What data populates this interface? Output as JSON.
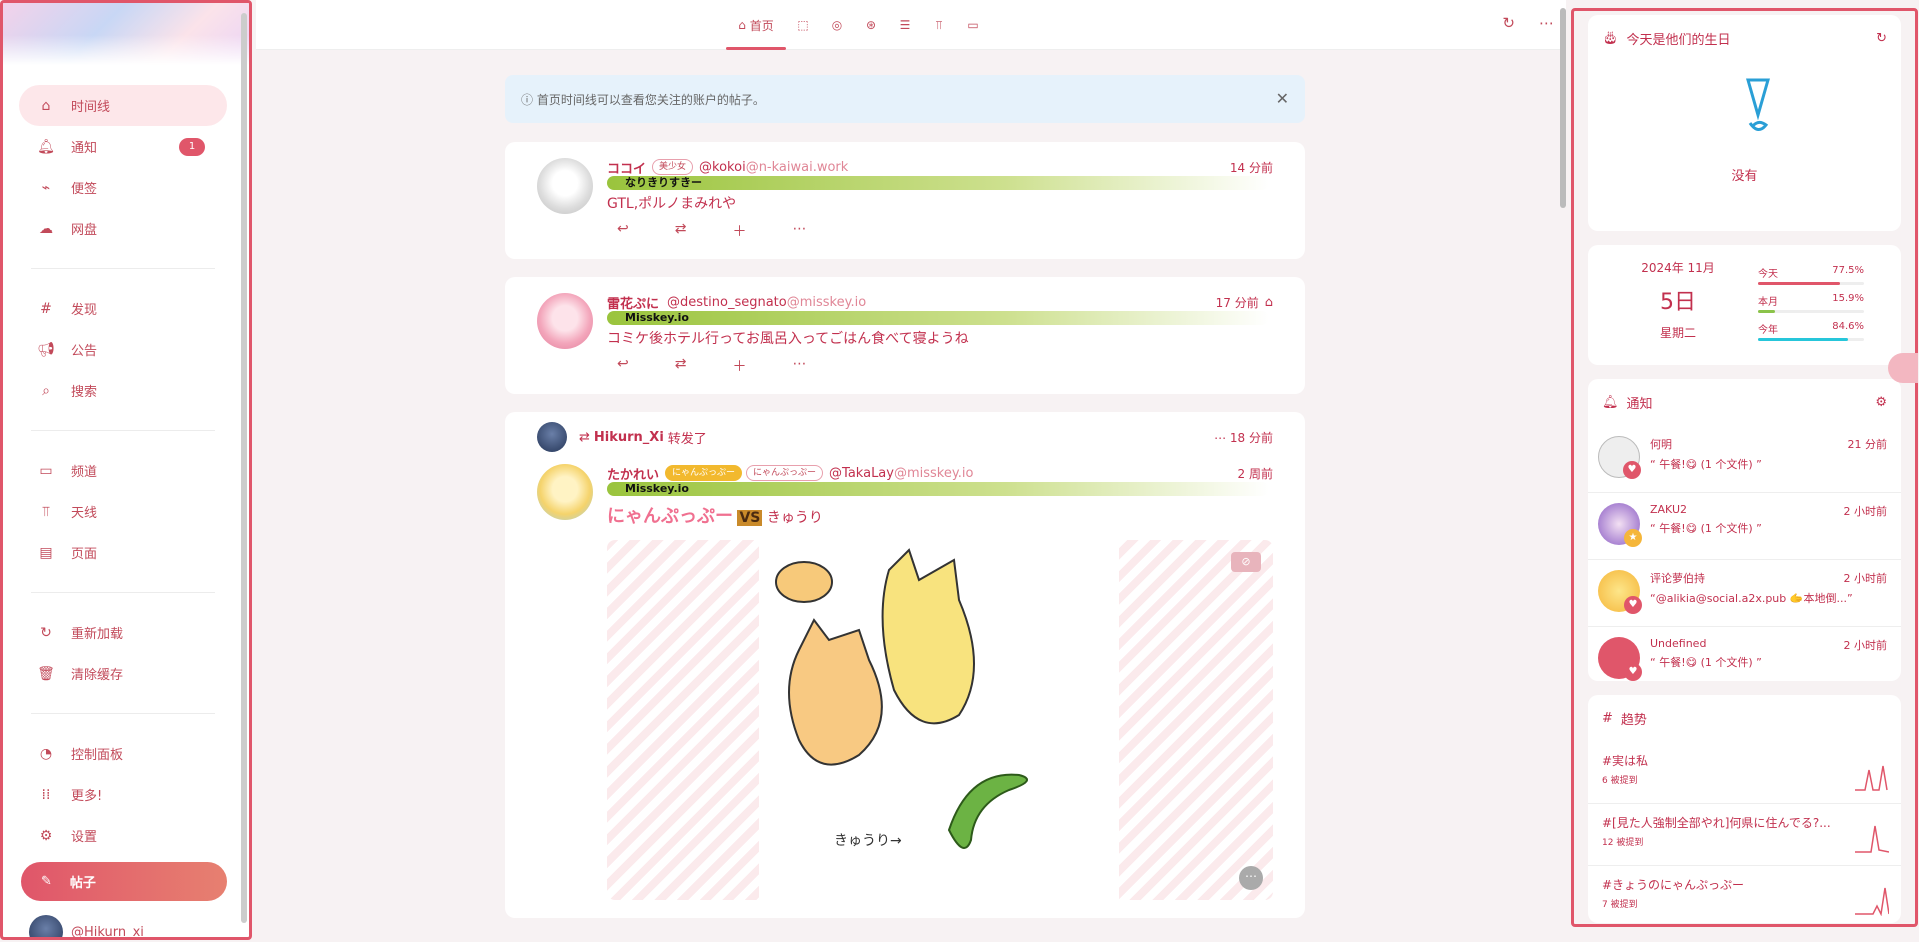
{
  "sidebar": {
    "items": [
      {
        "label": "时间线",
        "icon": "home-icon"
      },
      {
        "label": "通知",
        "icon": "bell-icon",
        "badge": "1"
      },
      {
        "label": "便签",
        "icon": "paperclip-icon"
      },
      {
        "label": "网盘",
        "icon": "cloud-icon"
      },
      {
        "label": "发现",
        "icon": "hash-icon"
      },
      {
        "label": "公告",
        "icon": "megaphone-icon"
      },
      {
        "label": "搜索",
        "icon": "search-icon"
      },
      {
        "label": "频道",
        "icon": "tv-icon"
      },
      {
        "label": "天线",
        "icon": "antenna-icon"
      },
      {
        "label": "页面",
        "icon": "page-icon"
      },
      {
        "label": "重新加载",
        "icon": "refresh-icon"
      },
      {
        "label": "清除缓存",
        "icon": "trash-icon"
      },
      {
        "label": "控制面板",
        "icon": "dashboard-icon"
      },
      {
        "label": "更多!",
        "icon": "grid-icon"
      },
      {
        "label": "设置",
        "icon": "gear-icon"
      }
    ],
    "post_label": "帖子",
    "username": "@Hikurn_xi"
  },
  "topbar": {
    "home_tab": "首页"
  },
  "info_banner": "首页时间线可以查看您关注的账户的帖子。",
  "notes": [
    {
      "name": "ココイ",
      "chip": "美少女",
      "handle": "@kokoi",
      "host": "@n-kaiwai.work",
      "instance": "なりきりすきー",
      "text": "GTL,ポルノまみれや",
      "time": "14 分前"
    },
    {
      "name": "雷花ぷに",
      "handle": "@destino_segnato",
      "host": "@misskey.io",
      "instance": "Misskey.io",
      "text": "コミケ後ホテル行ってお風呂入ってごはん食べて寝ようね",
      "time": "17 分前"
    }
  ],
  "renote": {
    "by": "Hikurn_Xi",
    "action": "转发了",
    "time": "18 分前",
    "name": "たかれい",
    "chip1": "にゃんぷっぷー",
    "chip2": "にゃんぷっぷー",
    "handle": "@TakaLay",
    "host": "@misskey.io",
    "instance": "Misskey.io",
    "title_art": "にゃんぷっぷー",
    "vs": "VS",
    "text": "きゅうり",
    "time2": "2 周前",
    "caption": "きゅうり→"
  },
  "birthday": {
    "title": "今天是他们的生日",
    "empty": "没有"
  },
  "date": {
    "ym": "2024年  11月",
    "day": "5日",
    "weekday": "星期二",
    "today_label": "今天",
    "today_pct": "77.5%",
    "today_value": 77.5,
    "month_label": "本月",
    "month_pct": "15.9%",
    "month_value": 15.9,
    "year_label": "今年",
    "year_pct": "84.6%",
    "year_value": 84.6
  },
  "notifications": {
    "title": "通知",
    "items": [
      {
        "name": "何明",
        "text": "“ 午餐!😋 (1 个文件) ”",
        "time": "21 分前"
      },
      {
        "name": "ZAKU2",
        "text": "“ 午餐!😋 (1 个文件) ”",
        "time": "2 小时前"
      },
      {
        "name": "评论萝伯持",
        "text": "“@alikia@social.a2x.pub 🫱本地倒...”",
        "time": "2 小时前"
      },
      {
        "name": "Undefined",
        "text": "“ 午餐!😋 (1 个文件) ”",
        "time": "2 小时前"
      }
    ]
  },
  "trends": {
    "title": "趋势",
    "items": [
      {
        "tag": "#実は私",
        "sub": "6 被提到"
      },
      {
        "tag": "#[見た人強制全部やれ]何県に住んでる?...",
        "sub": "12 被提到"
      },
      {
        "tag": "#きょうのにゃんぷっぷー",
        "sub": "7 被提到"
      }
    ]
  },
  "colors": {
    "accent": "#e0566a",
    "today_bar": "#e0566a",
    "month_bar": "#8bc34a",
    "year_bar": "#26c6da"
  }
}
